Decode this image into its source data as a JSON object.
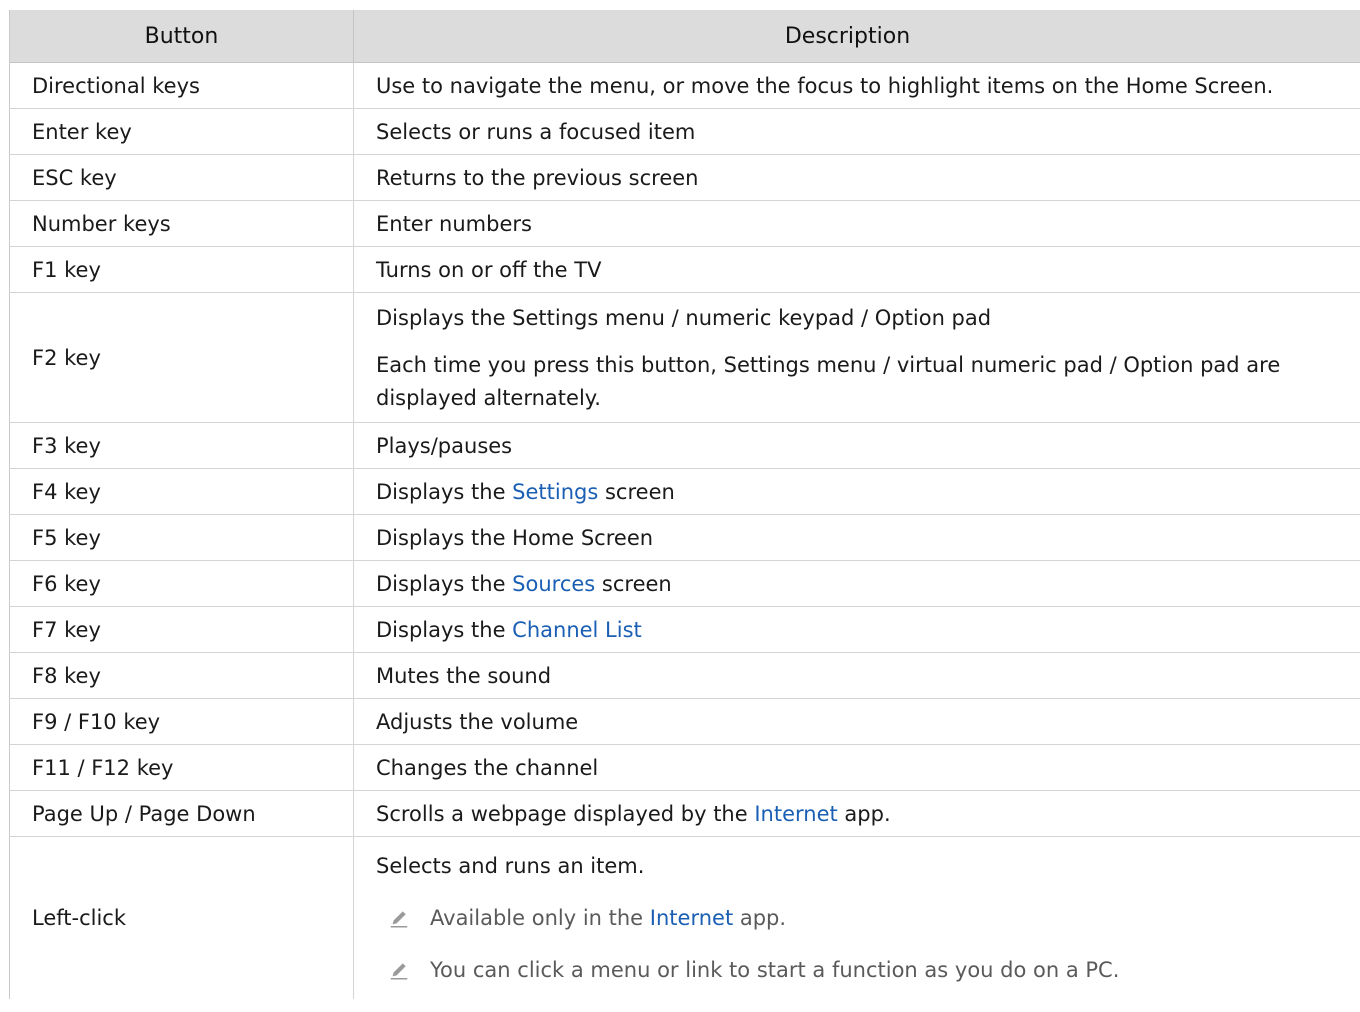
{
  "header": {
    "button": "Button",
    "description": "Description"
  },
  "rows": [
    {
      "button": "Directional keys",
      "description": "Use to navigate the menu, or move the focus to highlight items on the Home Screen."
    },
    {
      "button": "Enter key",
      "description": "Selects or runs a focused item"
    },
    {
      "button": "ESC key",
      "description": "Returns to the previous screen"
    },
    {
      "button": "Number keys",
      "description": "Enter numbers"
    },
    {
      "button": "F1 key",
      "description": "Turns on or off the TV"
    }
  ],
  "f2": {
    "button": "F2 key",
    "line1": "Displays the Settings menu / numeric keypad / Option pad",
    "line2a": "Each time you press this button, Settings menu / virtual numeric pad / Option pad are",
    "line2b": "displayed alternately."
  },
  "f3": {
    "button": "F3 key",
    "description": "Plays/pauses"
  },
  "f4": {
    "button": "F4 key",
    "pre": "Displays the ",
    "link": "Settings",
    "post": " screen"
  },
  "f5": {
    "button": "F5 key",
    "description": "Displays the Home Screen"
  },
  "f6": {
    "button": "F6 key",
    "pre": "Displays the ",
    "link": "Sources",
    "post": " screen"
  },
  "f7": {
    "button": "F7 key",
    "pre": "Displays the ",
    "link": "Channel List",
    "post": ""
  },
  "f8": {
    "button": "F8 key",
    "description": "Mutes the sound"
  },
  "f9": {
    "button": "F9 / F10 key",
    "description": "Adjusts the volume"
  },
  "f11": {
    "button": "F11 / F12 key",
    "description": "Changes the channel"
  },
  "page": {
    "button": "Page Up / Page Down",
    "pre": "Scrolls a webpage displayed by the ",
    "link": "Internet",
    "post": " app."
  },
  "leftclick": {
    "button": "Left-click",
    "main": "Selects and runs an item.",
    "note1_pre": "Available only in the ",
    "note1_link": "Internet",
    "note1_post": " app.",
    "note2": "You can click a menu or link to start a function as you do on a PC."
  },
  "colors": {
    "header_bg": "#dcdcdc",
    "link": "#1a5fb4",
    "note_text": "#5a5a5a"
  },
  "icons": {
    "note": "pencil-icon"
  }
}
